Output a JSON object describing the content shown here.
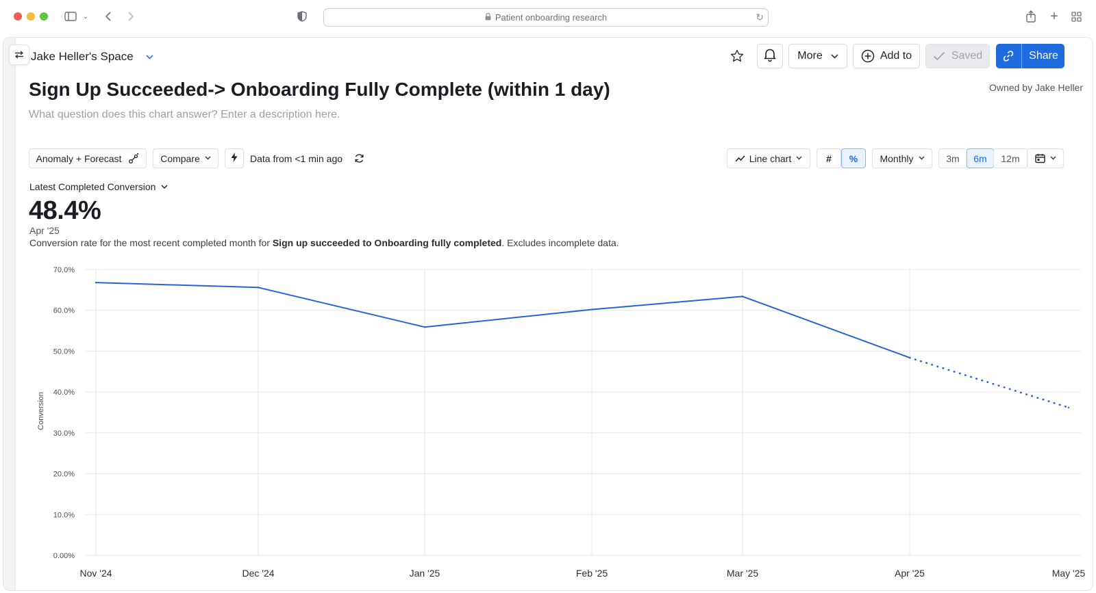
{
  "browser": {
    "url_text": "Patient onboarding research"
  },
  "header": {
    "space_name": "Jake Heller's Space",
    "more_label": "More",
    "add_to_label": "Add to",
    "saved_label": "Saved",
    "share_label": "Share"
  },
  "chart_info": {
    "title": "Sign Up Succeeded-> Onboarding Fully Complete (within 1 day)",
    "description_placeholder": "What question does this chart answer? Enter a description here.",
    "owner": "Owned by Jake Heller"
  },
  "toolbar": {
    "anomaly_label": "Anomaly + Forecast",
    "compare_label": "Compare",
    "data_freshness": "Data from <1 min ago",
    "chart_type_label": "Line chart",
    "count_label": "#",
    "percent_label": "%",
    "interval_label": "Monthly",
    "ranges": [
      "3m",
      "6m",
      "12m"
    ],
    "active_range": "6m"
  },
  "metric": {
    "label": "Latest Completed Conversion",
    "value": "48.4%",
    "date": "Apr '25",
    "note_prefix": "Conversion rate for the most recent completed month for ",
    "note_bold": "Sign up succeeded to Onboarding fully completed",
    "note_suffix": ". Excludes incomplete data."
  },
  "colors": {
    "accent": "#1f6be0",
    "line": "#2563d9"
  },
  "chart_data": {
    "type": "line",
    "x": [
      "Nov '24",
      "Dec '24",
      "Jan '25",
      "Feb '25",
      "Mar '25",
      "Apr '25",
      "May '25"
    ],
    "series": [
      {
        "values": [
          66.8,
          65.6,
          55.9,
          60.2,
          63.4,
          48.4,
          36.2
        ],
        "complete": [
          true,
          true,
          true,
          true,
          true,
          true,
          false
        ]
      }
    ],
    "ylabel": "Conversion",
    "yticks": [
      "0.00%",
      "10.0%",
      "20.0%",
      "30.0%",
      "40.0%",
      "50.0%",
      "60.0%",
      "70.0%"
    ],
    "ylim": [
      0,
      70
    ],
    "grid": true
  }
}
